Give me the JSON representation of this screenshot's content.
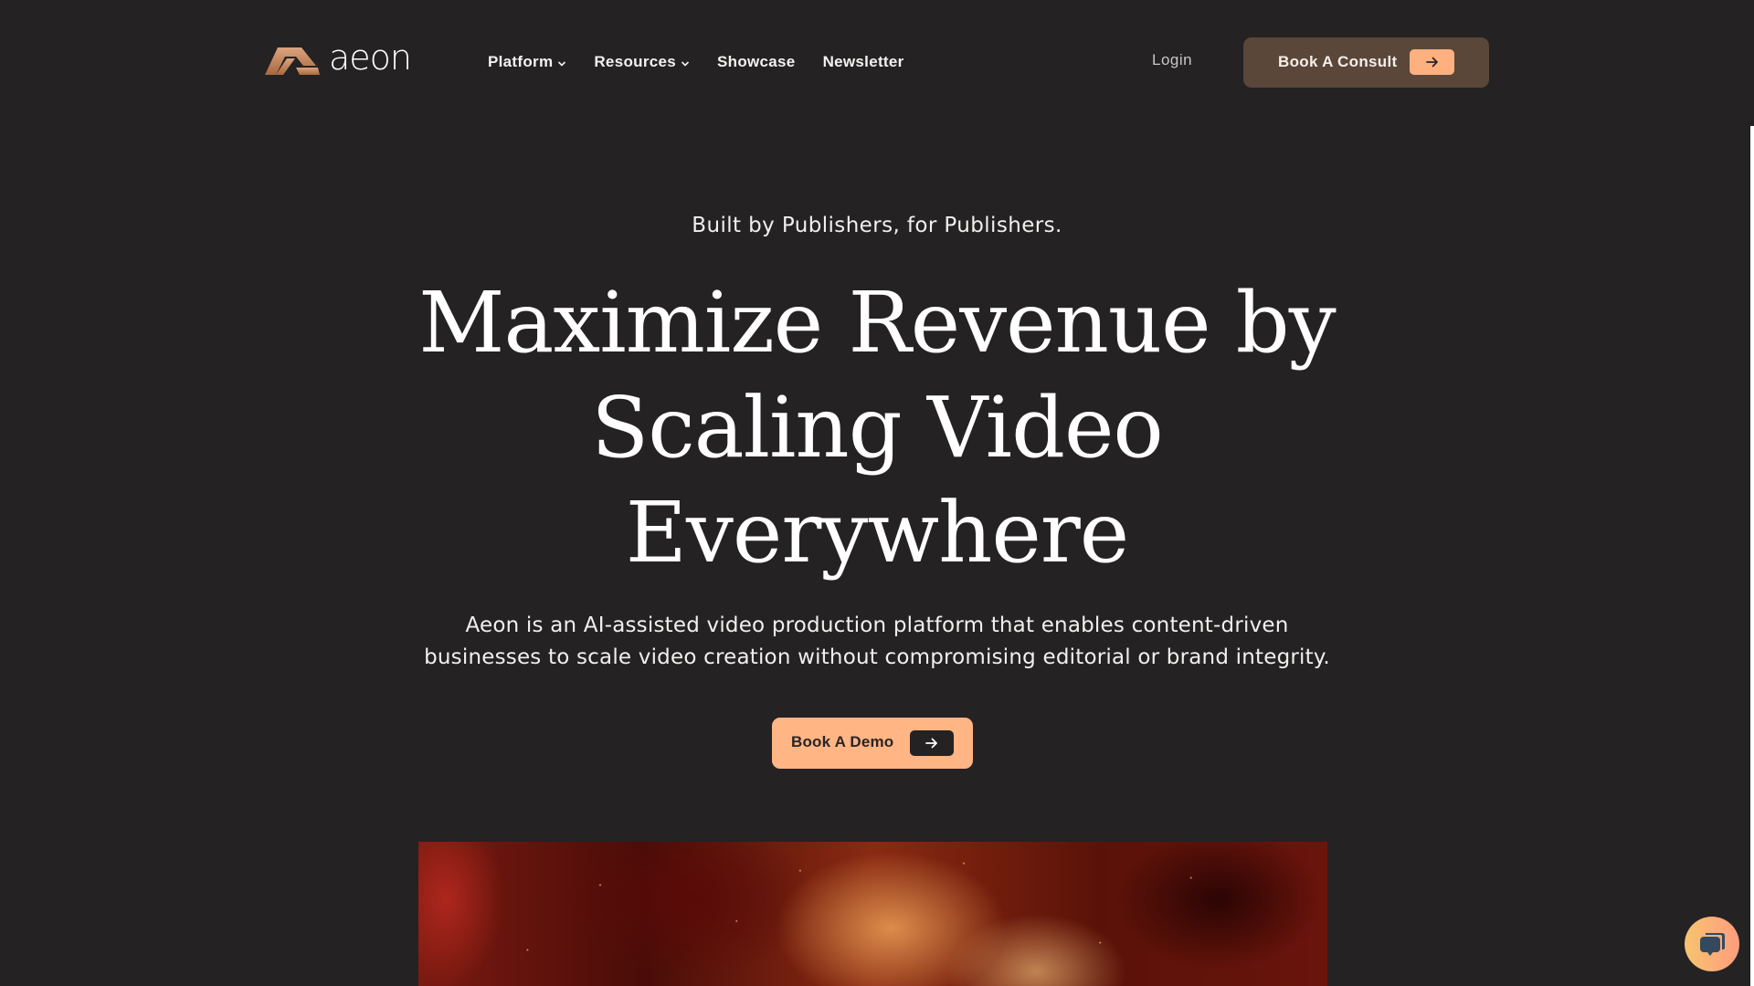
{
  "brand": {
    "name": "aeon",
    "logo_icon": "aeon-logo-mark",
    "logo_colors": [
      "#dba47d",
      "#a8683f"
    ]
  },
  "nav": {
    "items": [
      {
        "label": "Platform",
        "has_dropdown": true,
        "icon": "chevron-down-icon"
      },
      {
        "label": "Resources",
        "has_dropdown": true,
        "icon": "chevron-down-icon"
      },
      {
        "label": "Showcase",
        "has_dropdown": false
      },
      {
        "label": "Newsletter",
        "has_dropdown": false
      }
    ],
    "login_label": "Login",
    "cta": {
      "label": "Book A Consult",
      "icon": "arrow-right-icon"
    }
  },
  "hero": {
    "eyebrow": "Built by Publishers, for Publishers.",
    "headline_lines": [
      "Maximize Revenue by",
      "Scaling Video",
      "Everywhere"
    ],
    "description_lines": [
      "Aeon is an AI-assisted video production platform that enables content-driven",
      "businesses to scale video creation without compromising editorial or brand integrity."
    ],
    "cta": {
      "label": "Book A Demo",
      "icon": "arrow-right-icon"
    }
  },
  "media": {
    "video_preview": "abstract-fiery-smoke-video"
  },
  "chat_widget": {
    "icon": "chat-bubbles-icon"
  },
  "colors": {
    "background": "#242223",
    "consult_button": "#5a4739",
    "accent_peach": "#ffb584",
    "chat_gradient": [
      "#f6c470",
      "#ff9c7e"
    ],
    "chat_icon": "#34495e"
  }
}
